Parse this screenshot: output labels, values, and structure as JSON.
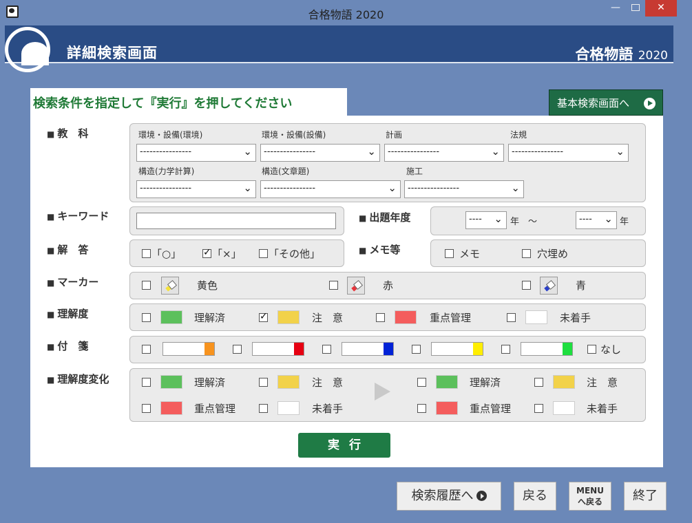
{
  "window": {
    "title": "合格物語 2020",
    "min": "—",
    "close": "✕"
  },
  "header": {
    "title": "詳細検索画面",
    "brand": "合格物語",
    "brand_year": "2020"
  },
  "panel": {
    "title": "検索条件を指定して『実行』を押してください",
    "basic_search_button": "基本検索画面へ"
  },
  "subjects": {
    "label": "教　科",
    "items": [
      {
        "label": "環境・設備(環境)",
        "value": "----------------"
      },
      {
        "label": "環境・設備(設備)",
        "value": "----------------"
      },
      {
        "label": "計画",
        "value": "----------------"
      },
      {
        "label": "法規",
        "value": "----------------"
      },
      {
        "label": "構造(力学計算)",
        "value": "----------------"
      },
      {
        "label": "構造(文章題)",
        "value": "----------------"
      },
      {
        "label": "施工",
        "value": "----------------"
      }
    ]
  },
  "keyword": {
    "label": "キーワード",
    "value": ""
  },
  "year": {
    "label": "出題年度",
    "from": "----",
    "to": "----",
    "unit_from": "年　～",
    "unit_to": "年"
  },
  "answer": {
    "label": "解　答",
    "options": [
      {
        "text": "「○」",
        "checked": false
      },
      {
        "text": "「×」",
        "checked": true
      },
      {
        "text": "「その他」",
        "checked": false
      }
    ]
  },
  "memo": {
    "label": "メモ等",
    "options": [
      {
        "text": "メモ",
        "checked": false
      },
      {
        "text": "穴埋め",
        "checked": false
      }
    ]
  },
  "marker": {
    "label": "マーカー",
    "options": [
      {
        "text": "黄色",
        "color": "#f5e23a"
      },
      {
        "text": "赤",
        "color": "#e8343b"
      },
      {
        "text": "青",
        "color": "#2a3fc9"
      }
    ]
  },
  "understanding": {
    "label": "理解度",
    "options": [
      {
        "text": "理解済",
        "color": "#5cc05c",
        "checked": false
      },
      {
        "text": "注　意",
        "color": "#f2d24a",
        "checked": true
      },
      {
        "text": "重点管理",
        "color": "#f45d5d",
        "checked": false
      },
      {
        "text": "未着手",
        "color": "#ffffff",
        "checked": false
      }
    ]
  },
  "tags": {
    "label": "付　箋",
    "colors": [
      "#f7931e",
      "#e60012",
      "#0022d6",
      "#ffee00",
      "#1ede3f"
    ],
    "none_label": "なし"
  },
  "understanding_change": {
    "label": "理解度変化",
    "from": [
      {
        "text": "理解済",
        "color": "#5cc05c"
      },
      {
        "text": "注　意",
        "color": "#f2d24a"
      },
      {
        "text": "重点管理",
        "color": "#f45d5d"
      },
      {
        "text": "未着手",
        "color": "#ffffff"
      }
    ],
    "to": [
      {
        "text": "理解済",
        "color": "#5cc05c"
      },
      {
        "text": "注　意",
        "color": "#f2d24a"
      },
      {
        "text": "重点管理",
        "color": "#f45d5d"
      },
      {
        "text": "未着手",
        "color": "#ffffff"
      }
    ]
  },
  "execute": "実行",
  "footer": {
    "history": "検索履歴へ",
    "back": "戻る",
    "menu_line1": "MENU",
    "menu_line2": "へ戻る",
    "exit": "終了"
  }
}
